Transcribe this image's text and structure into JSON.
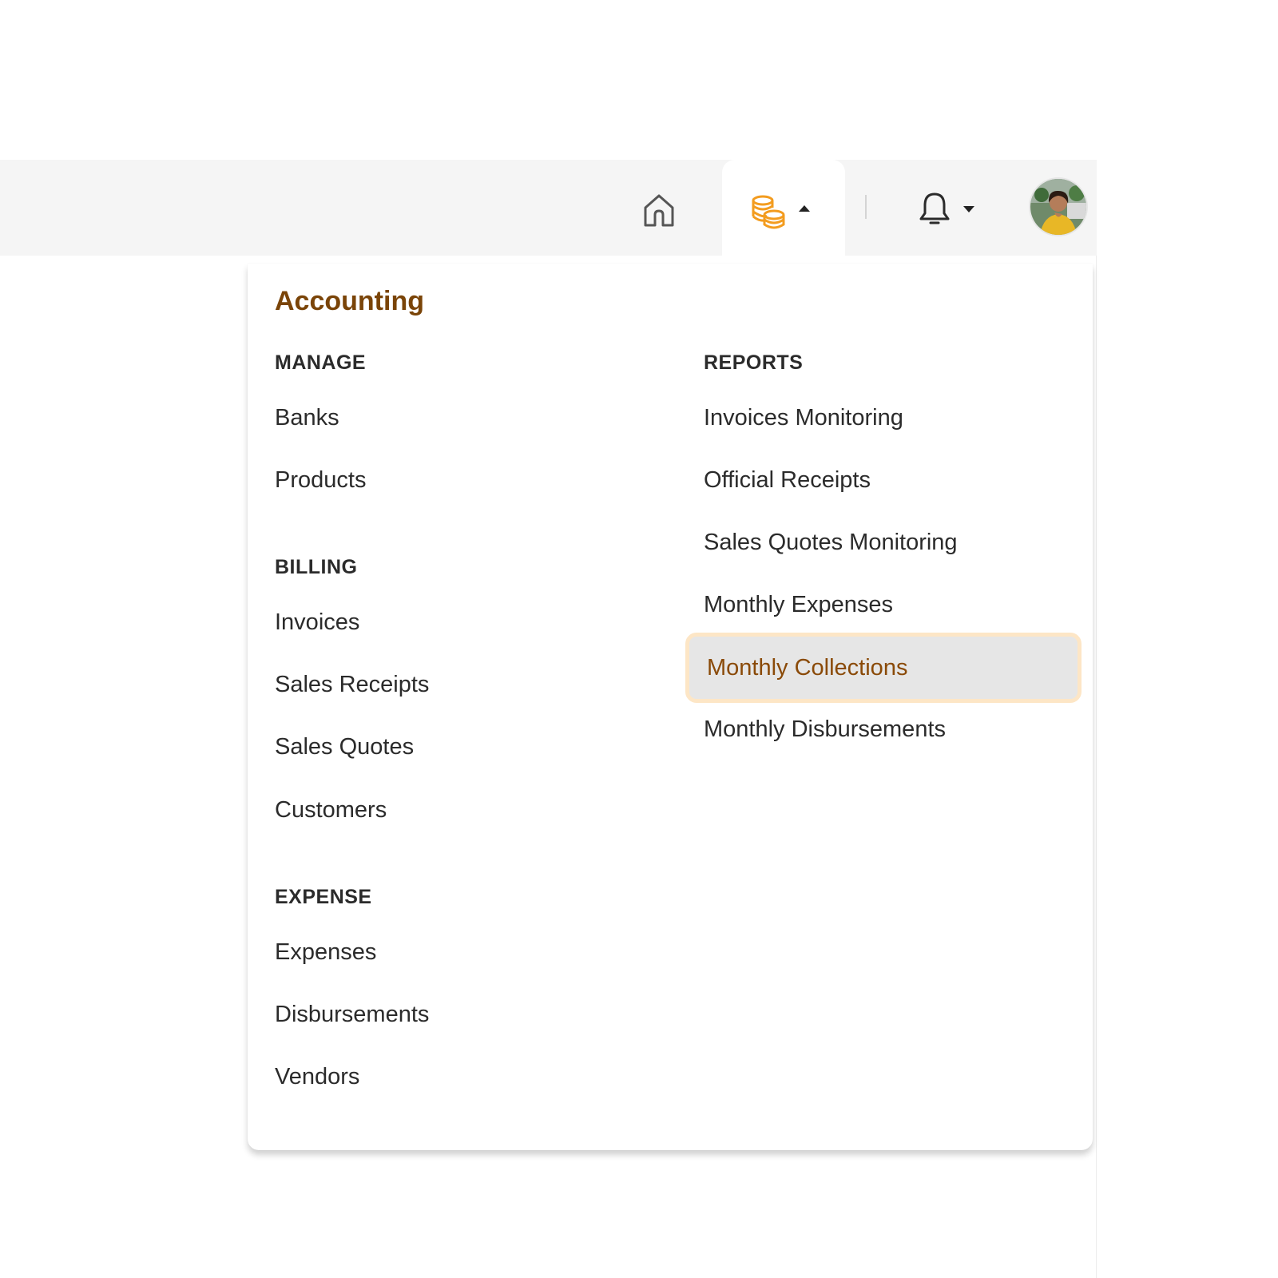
{
  "top_bar": {
    "home_icon": "home-icon",
    "accounting_icon": "coins-icon",
    "accounting_caret": "caret-up-icon",
    "notifications_icon": "bell-icon",
    "notifications_caret": "caret-down-icon"
  },
  "colors": {
    "accent": "#f39c1f",
    "title_brown": "#7a4408",
    "active_text": "#8a4a08",
    "highlight_bg": "#e6e6e6",
    "highlight_border": "#fde6c6"
  },
  "menu": {
    "title": "Accounting",
    "manage": {
      "label": "MANAGE",
      "items": [
        "Banks",
        "Products"
      ]
    },
    "billing": {
      "label": "BILLING",
      "items": [
        "Invoices",
        "Sales Receipts",
        "Sales Quotes",
        "Customers"
      ]
    },
    "expense": {
      "label": "EXPENSE",
      "items": [
        "Expenses",
        "Disbursements",
        "Vendors"
      ]
    },
    "reports": {
      "label": "REPORTS",
      "items": [
        "Invoices Monitoring",
        "Official Receipts",
        "Sales Quotes Monitoring",
        "Monthly Expenses",
        "Monthly Collections",
        "Monthly Disbursements"
      ],
      "active_item": "Monthly Collections"
    }
  }
}
